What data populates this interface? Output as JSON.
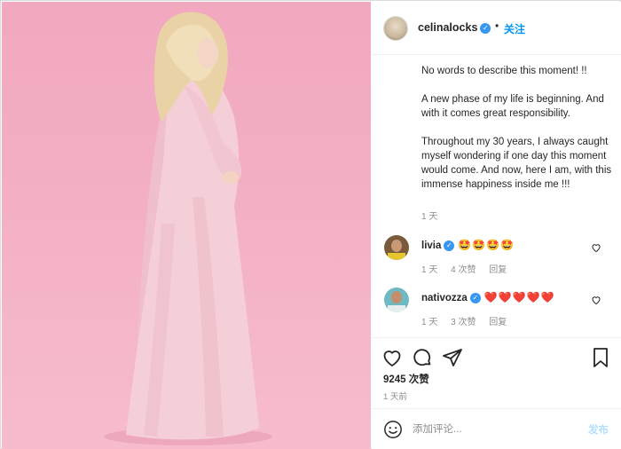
{
  "post": {
    "username": "celinalocks",
    "separator": "•",
    "follow_label": "关注",
    "caption": "No words to describe this moment! !!\n\nA new phase of my life is beginning. And with it comes great responsibility.\n\nThroughout my 30 years, I always caught myself wondering if one day this moment would come. And now, here I am, with this immense happiness inside me !!!",
    "caption_time": "1 天"
  },
  "comments": [
    {
      "username": "livia",
      "text": "🤩🤩🤩🤩",
      "time": "1 天",
      "likes": "4 次赞",
      "reply": "回复"
    },
    {
      "username": "nativozza",
      "text": "❤️❤️❤️❤️❤️",
      "time": "1 天",
      "likes": "3 次赞",
      "reply": "回复"
    }
  ],
  "likes": "9245 次赞",
  "post_time": "1 天前",
  "comment_box": {
    "placeholder": "添加评论...",
    "post_label": "发布"
  },
  "colors": {
    "accent": "#0095f6",
    "post_disabled": "#b2dffc",
    "verified": "#3897f0",
    "photo_bg": "#f3b0c3"
  },
  "icons": [
    "heart-icon",
    "comment-icon",
    "share-icon",
    "bookmark-icon",
    "emoji-icon",
    "verified-icon"
  ]
}
